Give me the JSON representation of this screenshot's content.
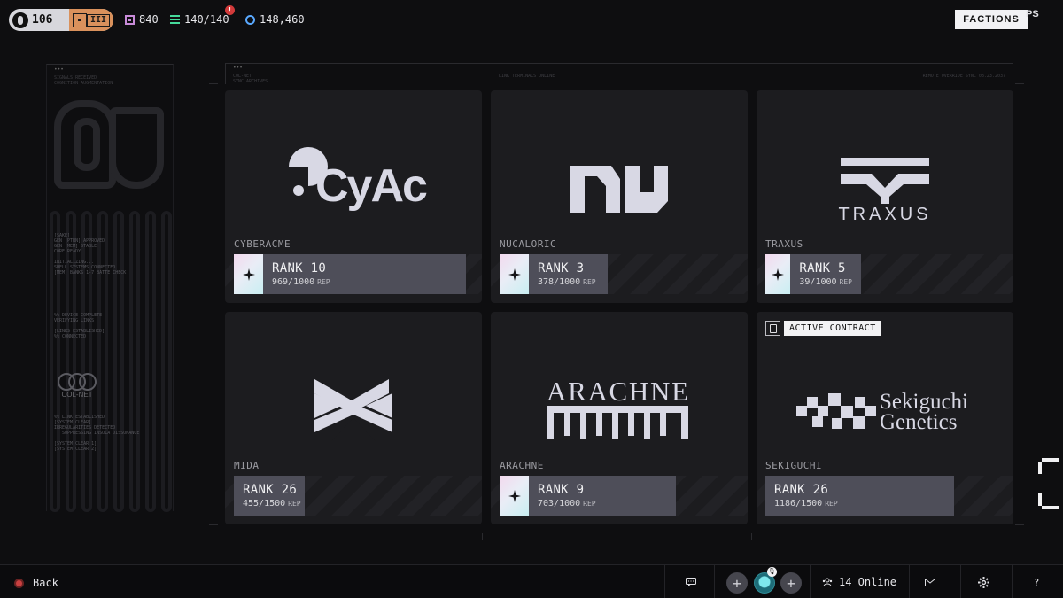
{
  "topbar": {
    "level": "106",
    "tier_numeral": "III",
    "currencies": [
      {
        "icon": "purple-chip-icon",
        "value": "840",
        "color": "#c98bd9"
      },
      {
        "icon": "green-stack-icon",
        "value": "140/140",
        "color": "#45d99a"
      },
      {
        "icon": "blue-credit-icon",
        "value": "148,460",
        "color": "#5aa9ff"
      }
    ],
    "alert_glyph": "!",
    "factions_label": "FACTIONS",
    "clipped_label": "PS"
  },
  "side_panel": {
    "dots": "•••",
    "header": "SIGNALS RECEIVED\nCOGNITION AUGMENTATION",
    "log": "[SAKE]\nGEN [PTRN] APPROVED\nGEN [MEM] STABLE\nCORE READY\n\nINITIALIZING...\nSHELL SYSTEMS CONNECTED\n[MEM] BANKS 1-7 BATTE CHECK\n\n\n\n\n\n\n\n%% DEVICE COMPLETE\nVERIFYING LINKS\n\n[LINKS ESTABLISHED]\n%% CONNECTED",
    "logo_label": "COL-NET",
    "log2": "%% LINK ESTABLISHED\n[SYSTEM CLEAR]\nIRREGULARITIES DETECTED\n   SUPPRESSING INSULA DISSONANCE\n\n[SYSTEM CLEAR 1]\n[SYSTEM CLEAR 2]"
  },
  "main_frame": {
    "dots": "•••",
    "left_text": "COL-NET\nSYNC ARCHIVES",
    "center_text": "LINK TERMINALS ONLINE",
    "right_text": "REMOTE OVERRIDE SYNC 08.23.2037"
  },
  "cards": [
    {
      "name": "CYBERACME",
      "rank": "RANK 10",
      "rep": "969/1000",
      "rep_unit": "REP",
      "logo_text": "CyAc",
      "rep_fraction": 0.969
    },
    {
      "name": "NUCALORIC",
      "rank": "RANK 3",
      "rep": "378/1000",
      "rep_unit": "REP",
      "rep_fraction": 0.378
    },
    {
      "name": "TRAXUS",
      "rank": "RANK 5",
      "rep": "39/1000",
      "rep_unit": "REP",
      "logo_text": "TRAXUS",
      "rep_fraction": 0.039
    },
    {
      "name": "MIDA",
      "rank": "RANK 26",
      "rep": "455/1500",
      "rep_unit": "REP",
      "rep_fraction": 0.303
    },
    {
      "name": "ARACHNE",
      "rank": "RANK 9",
      "rep": "703/1000",
      "rep_unit": "REP",
      "logo_text": "ARACHNE",
      "rep_fraction": 0.703
    },
    {
      "name": "SEKIGUCHI",
      "rank": "RANK 26",
      "rep": "1186/1500",
      "rep_unit": "REP",
      "logo_text_1": "Sekiguchi",
      "logo_text_2": "Genetics",
      "active_contract": "ACTIVE CONTRACT",
      "rep_fraction": 0.791
    }
  ],
  "bottombar": {
    "back_label": "Back",
    "online_label": "14 Online",
    "add_glyph": "+",
    "help_glyph": "?",
    "mic_glyph": "🎙"
  }
}
